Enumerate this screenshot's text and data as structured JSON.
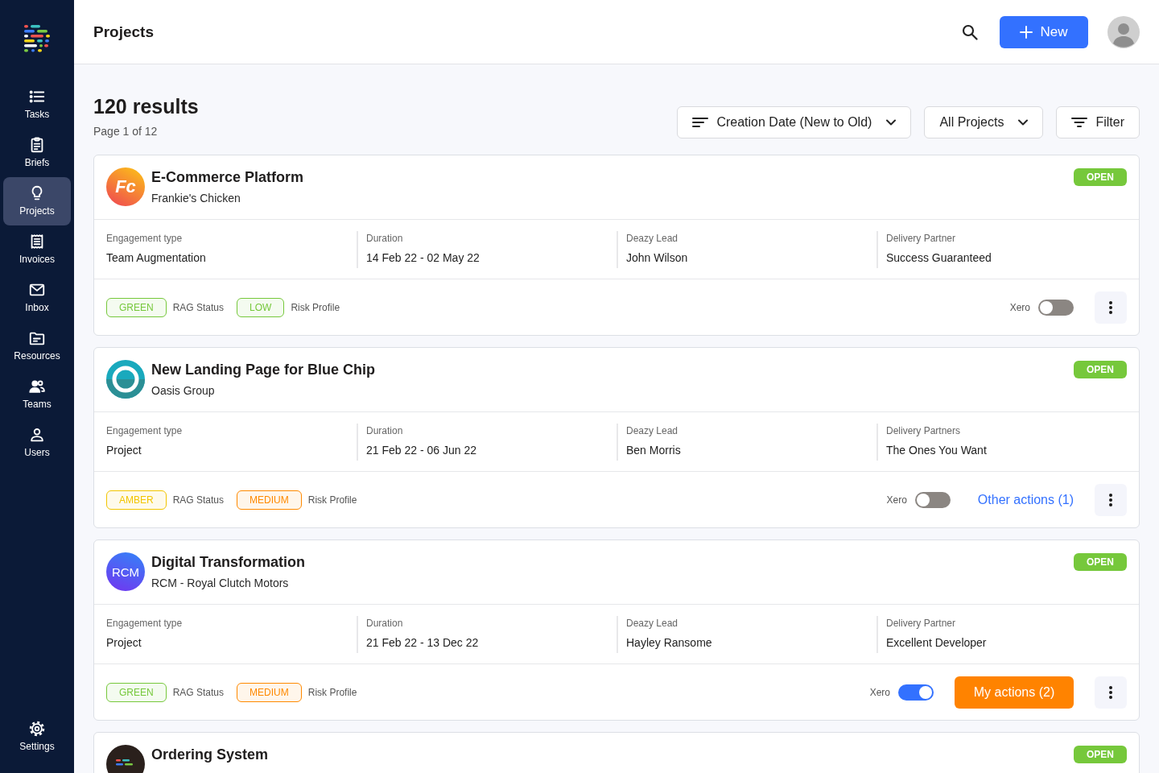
{
  "sidebar": {
    "items": [
      {
        "label": "Tasks",
        "selected": false
      },
      {
        "label": "Briefs",
        "selected": false
      },
      {
        "label": "Projects",
        "selected": true
      },
      {
        "label": "Invoices",
        "selected": false
      },
      {
        "label": "Inbox",
        "selected": false
      },
      {
        "label": "Resources",
        "selected": false
      },
      {
        "label": "Teams",
        "selected": false
      },
      {
        "label": "Users",
        "selected": false
      }
    ],
    "bottom_items": [
      {
        "label": "Settings",
        "selected": false
      }
    ]
  },
  "header": {
    "title": "Projects",
    "new_button": "New"
  },
  "results": {
    "count": "120 results",
    "page": "Page 1 of 12"
  },
  "controls": {
    "sort": "Creation Date (New to Old)",
    "scope": "All Projects",
    "filter": "Filter"
  },
  "projects": [
    {
      "logo": {
        "kind": "monogram",
        "text": "Fc"
      },
      "title": "E-Commerce Platform",
      "client": "Frankie's Chicken",
      "status": "OPEN",
      "details": [
        {
          "label": "Engagement type",
          "value": "Team Augmentation"
        },
        {
          "label": "Duration",
          "value": "14 Feb 22 - 02 May 22"
        },
        {
          "label": "Deazy Lead",
          "value": "John Wilson"
        },
        {
          "label": "Delivery Partner",
          "value": "Success Guaranteed"
        }
      ],
      "rag": {
        "label": "GREEN",
        "color": "#76c83b",
        "caption": "RAG Status"
      },
      "risk": {
        "label": "LOW",
        "color": "#76c83b",
        "caption": "Risk Profile"
      },
      "xero": {
        "label": "Xero",
        "on": false
      }
    },
    {
      "logo": {
        "kind": "ring"
      },
      "title": "New Landing Page for Blue Chip",
      "client": "Oasis Group",
      "status": "OPEN",
      "details": [
        {
          "label": "Engagement type",
          "value": "Project"
        },
        {
          "label": "Duration",
          "value": "21 Feb 22 - 06 Jun 22"
        },
        {
          "label": "Deazy Lead",
          "value": "Ben Morris"
        },
        {
          "label": "Delivery Partners",
          "value": "The Ones You Want"
        }
      ],
      "rag": {
        "label": "AMBER",
        "color": "#f2c500",
        "caption": "RAG Status"
      },
      "risk": {
        "label": "MEDIUM",
        "color": "#ff8a00",
        "caption": "Risk Profile"
      },
      "xero": {
        "label": "Xero",
        "on": false
      },
      "action": {
        "kind": "link",
        "label": "Other actions (1)"
      }
    },
    {
      "logo": {
        "kind": "monogram",
        "text": "RCM"
      },
      "title": "Digital Transformation",
      "client": "RCM - Royal Clutch Motors",
      "status": "OPEN",
      "details": [
        {
          "label": "Engagement type",
          "value": "Project"
        },
        {
          "label": "Duration",
          "value": "21 Feb 22 - 13 Dec 22"
        },
        {
          "label": "Deazy Lead",
          "value": "Hayley Ransome"
        },
        {
          "label": "Delivery Partner",
          "value": "Excellent Developer"
        }
      ],
      "rag": {
        "label": "GREEN",
        "color": "#76c83b",
        "caption": "RAG Status"
      },
      "risk": {
        "label": "MEDIUM",
        "color": "#ff8a00",
        "caption": "Risk Profile"
      },
      "xero": {
        "label": "Xero",
        "on": true
      },
      "action": {
        "kind": "button",
        "label": "My actions (2)"
      }
    },
    {
      "logo": {
        "kind": "mark"
      },
      "title": "Ordering System",
      "status": "OPEN"
    }
  ]
}
